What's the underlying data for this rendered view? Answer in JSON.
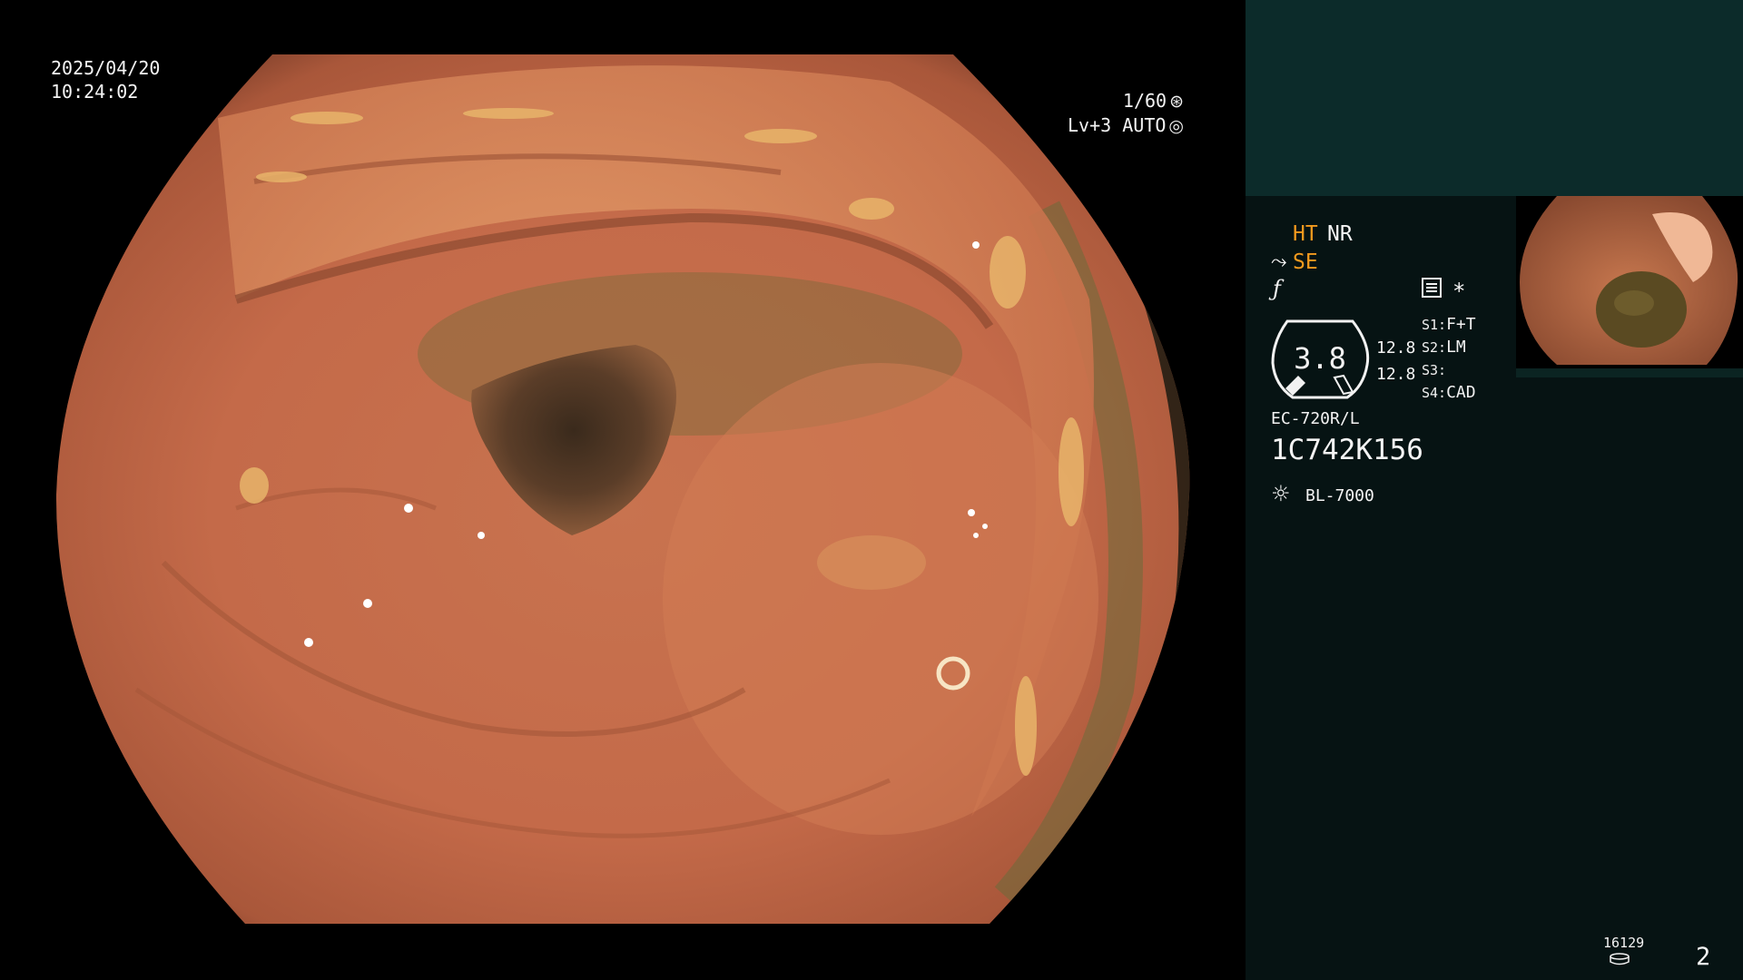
{
  "video": {
    "date": "2025/04/20",
    "time": "10:24:02",
    "shutter": "1/60",
    "shutter_icon": "aperture-icon",
    "level": "Lv+3",
    "mode": "AUTO",
    "mode_icon": "target-icon"
  },
  "panel": {
    "ht": "HT",
    "nr": "NR",
    "se": "SE",
    "se_icon": "tilde-arrow-icon",
    "f_icon": "f-hook-icon",
    "settings_icon": "settings-list-icon",
    "asterisk": "*",
    "iris_value": "3.8",
    "left_values": [
      "12.8",
      "12.8"
    ],
    "switches": [
      {
        "key": "S1:",
        "value": "F+T"
      },
      {
        "key": "S2:",
        "value": "LM"
      },
      {
        "key": "S3:",
        "value": ""
      },
      {
        "key": "S4:",
        "value": "CAD"
      }
    ],
    "scope_model": "EC-720R/L",
    "scope_serial": "1C742K156",
    "light_source": "BL-7000",
    "light_icon": "sun-icon",
    "counter": "16129",
    "counter_icon": "disk-icon",
    "page_number": "2"
  },
  "colors": {
    "accent_orange": "#f39a1e",
    "panel_bg": "#061313",
    "panel_top_bg": "#0c2b2a",
    "mucosa": "#c9704f"
  }
}
